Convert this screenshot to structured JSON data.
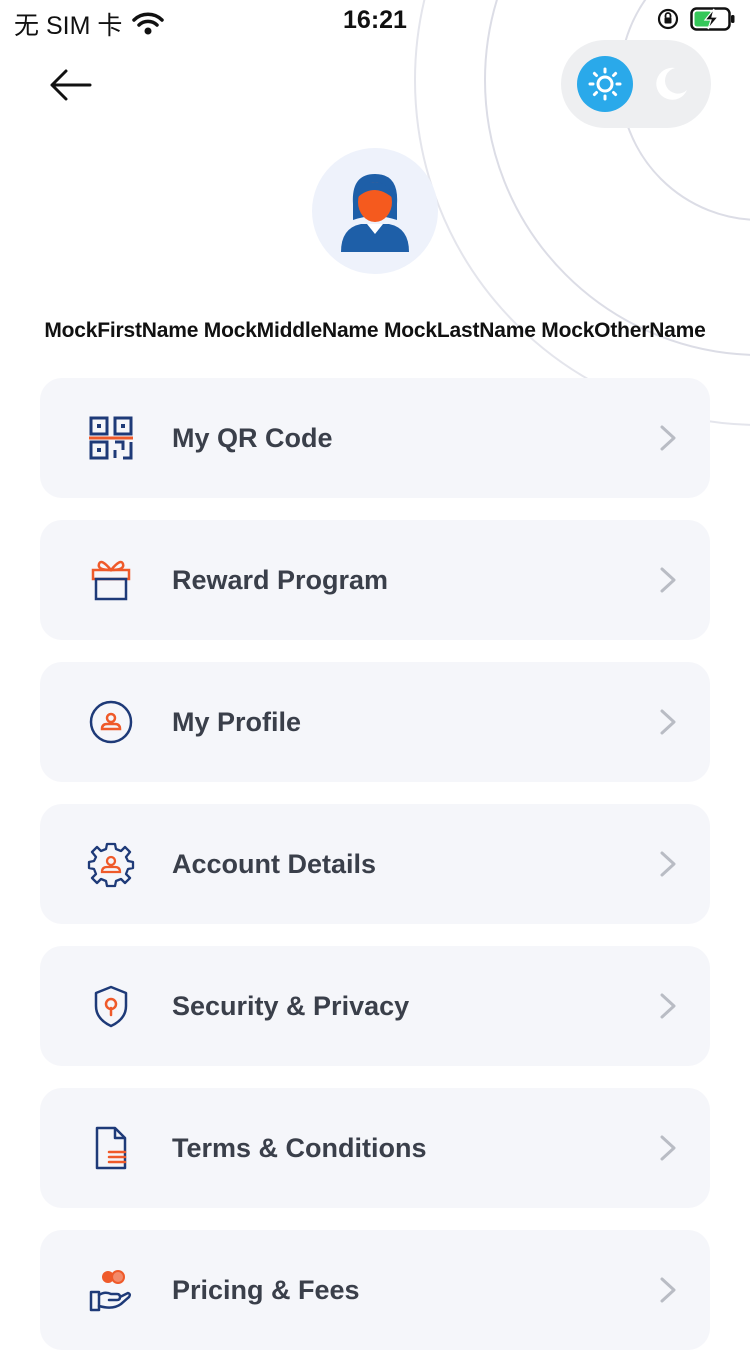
{
  "status_bar": {
    "carrier": "无 SIM 卡",
    "time": "16:21"
  },
  "theme_toggle": {
    "selected": "light"
  },
  "profile": {
    "full_name": "MockFirstName MockMiddleName MockLastName MockOtherName"
  },
  "menu": {
    "items": [
      {
        "label": "My QR Code",
        "icon": "qr-code-icon"
      },
      {
        "label": "Reward Program",
        "icon": "gift-icon"
      },
      {
        "label": "My Profile",
        "icon": "user-circle-icon"
      },
      {
        "label": "Account Details",
        "icon": "user-gear-icon"
      },
      {
        "label": "Security & Privacy",
        "icon": "shield-lock-icon"
      },
      {
        "label": "Terms & Conditions",
        "icon": "document-icon"
      },
      {
        "label": "Pricing & Fees",
        "icon": "coins-hand-icon"
      }
    ]
  },
  "colors": {
    "navy": "#1e3a78",
    "orange": "#ef5a2a",
    "accent_blue": "#2aa9ea",
    "card_bg": "#f5f6fa"
  }
}
